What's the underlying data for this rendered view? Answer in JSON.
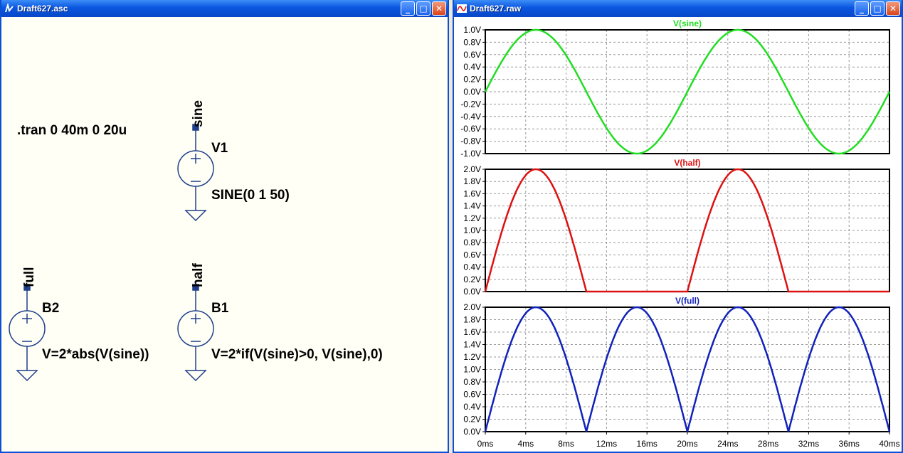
{
  "schematic_window": {
    "title": "Draft627.asc",
    "directive": ".tran 0 40m 0 20u",
    "v1": {
      "name": "V1",
      "value": "SINE(0 1 50)",
      "net": "sine"
    },
    "b2": {
      "name": "B2",
      "value": "V=2*abs(V(sine))",
      "net": "full"
    },
    "b1": {
      "name": "B1",
      "value": "V=2*if(V(sine)>0, V(sine),0)",
      "net": "half"
    }
  },
  "waveform_window": {
    "title": "Draft627.raw",
    "colors": {
      "sine": "#22dd22",
      "half": "#dd1111",
      "full": "#1122bb",
      "grid": "#999999"
    },
    "x_ticks": [
      "0ms",
      "4ms",
      "8ms",
      "12ms",
      "16ms",
      "20ms",
      "24ms",
      "28ms",
      "32ms",
      "36ms",
      "40ms"
    ]
  },
  "window_buttons": {
    "minimize": "_",
    "maximize": "□",
    "close": "✕"
  },
  "chart_data": [
    {
      "type": "line",
      "title": "V(sine)",
      "x_unit": "ms",
      "xlim": [
        0,
        40
      ],
      "ylim": [
        -1.0,
        1.0
      ],
      "y_ticks": [
        "1.0V",
        "0.8V",
        "0.6V",
        "0.4V",
        "0.2V",
        "0.0V",
        "-0.2V",
        "-0.4V",
        "-0.6V",
        "-0.8V",
        "-1.0V"
      ],
      "series": [
        {
          "name": "V(sine)",
          "x": [
            0,
            2.5,
            5,
            7.5,
            10,
            12.5,
            15,
            17.5,
            20,
            22.5,
            25,
            27.5,
            30,
            32.5,
            35,
            37.5,
            40
          ],
          "y": [
            0,
            0.71,
            1,
            0.71,
            0,
            -0.71,
            -1,
            -0.71,
            0,
            0.71,
            1,
            0.71,
            0,
            -0.71,
            -1,
            -0.71,
            0
          ]
        }
      ]
    },
    {
      "type": "line",
      "title": "V(half)",
      "x_unit": "ms",
      "xlim": [
        0,
        40
      ],
      "ylim": [
        0.0,
        2.0
      ],
      "y_ticks": [
        "2.0V",
        "1.8V",
        "1.6V",
        "1.4V",
        "1.2V",
        "1.0V",
        "0.8V",
        "0.6V",
        "0.4V",
        "0.2V",
        "0.0V"
      ],
      "series": [
        {
          "name": "V(half)",
          "x": [
            0,
            2.5,
            5,
            7.5,
            10,
            12.5,
            15,
            17.5,
            20,
            22.5,
            25,
            27.5,
            30,
            32.5,
            35,
            37.5,
            40
          ],
          "y": [
            0,
            1.41,
            2,
            1.41,
            0,
            0,
            0,
            0,
            0,
            1.41,
            2,
            1.41,
            0,
            0,
            0,
            0,
            0
          ]
        }
      ]
    },
    {
      "type": "line",
      "title": "V(full)",
      "x_unit": "ms",
      "xlim": [
        0,
        40
      ],
      "ylim": [
        0.0,
        2.0
      ],
      "y_ticks": [
        "2.0V",
        "1.8V",
        "1.6V",
        "1.4V",
        "1.2V",
        "1.0V",
        "0.8V",
        "0.6V",
        "0.4V",
        "0.2V",
        "0.0V"
      ],
      "series": [
        {
          "name": "V(full)",
          "x": [
            0,
            2.5,
            5,
            7.5,
            10,
            12.5,
            15,
            17.5,
            20,
            22.5,
            25,
            27.5,
            30,
            32.5,
            35,
            37.5,
            40
          ],
          "y": [
            0,
            1.41,
            2,
            1.41,
            0,
            1.41,
            2,
            1.41,
            0,
            1.41,
            2,
            1.41,
            0,
            1.41,
            2,
            1.41,
            0
          ]
        }
      ]
    }
  ]
}
